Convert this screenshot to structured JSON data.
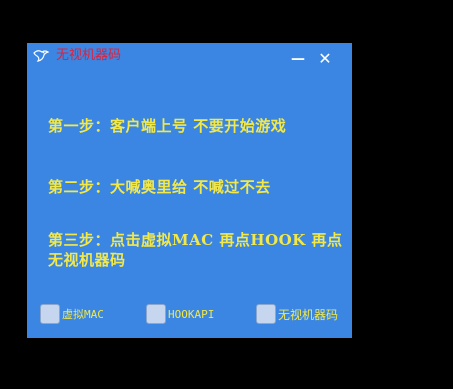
{
  "window": {
    "title": "无视机器码",
    "icon": "app-bird-icon",
    "minimize_label": "—",
    "close_label": "✕"
  },
  "steps": [
    "第一步：客户端上号 不要开始游戏",
    "第二步：大喊奥里给 不喊过不去",
    "第三步：点击虚拟MAC 再点HOOK 再点无视机器码"
  ],
  "options": [
    {
      "label": "虚拟MAC",
      "checked": false
    },
    {
      "label": "HOOKAPI",
      "checked": false
    },
    {
      "label": "无视机器码",
      "checked": false
    }
  ],
  "colors": {
    "background": "#000000",
    "window": "#3a86e2",
    "title_text": "#e0203a",
    "step_text": "#f2e84a"
  }
}
